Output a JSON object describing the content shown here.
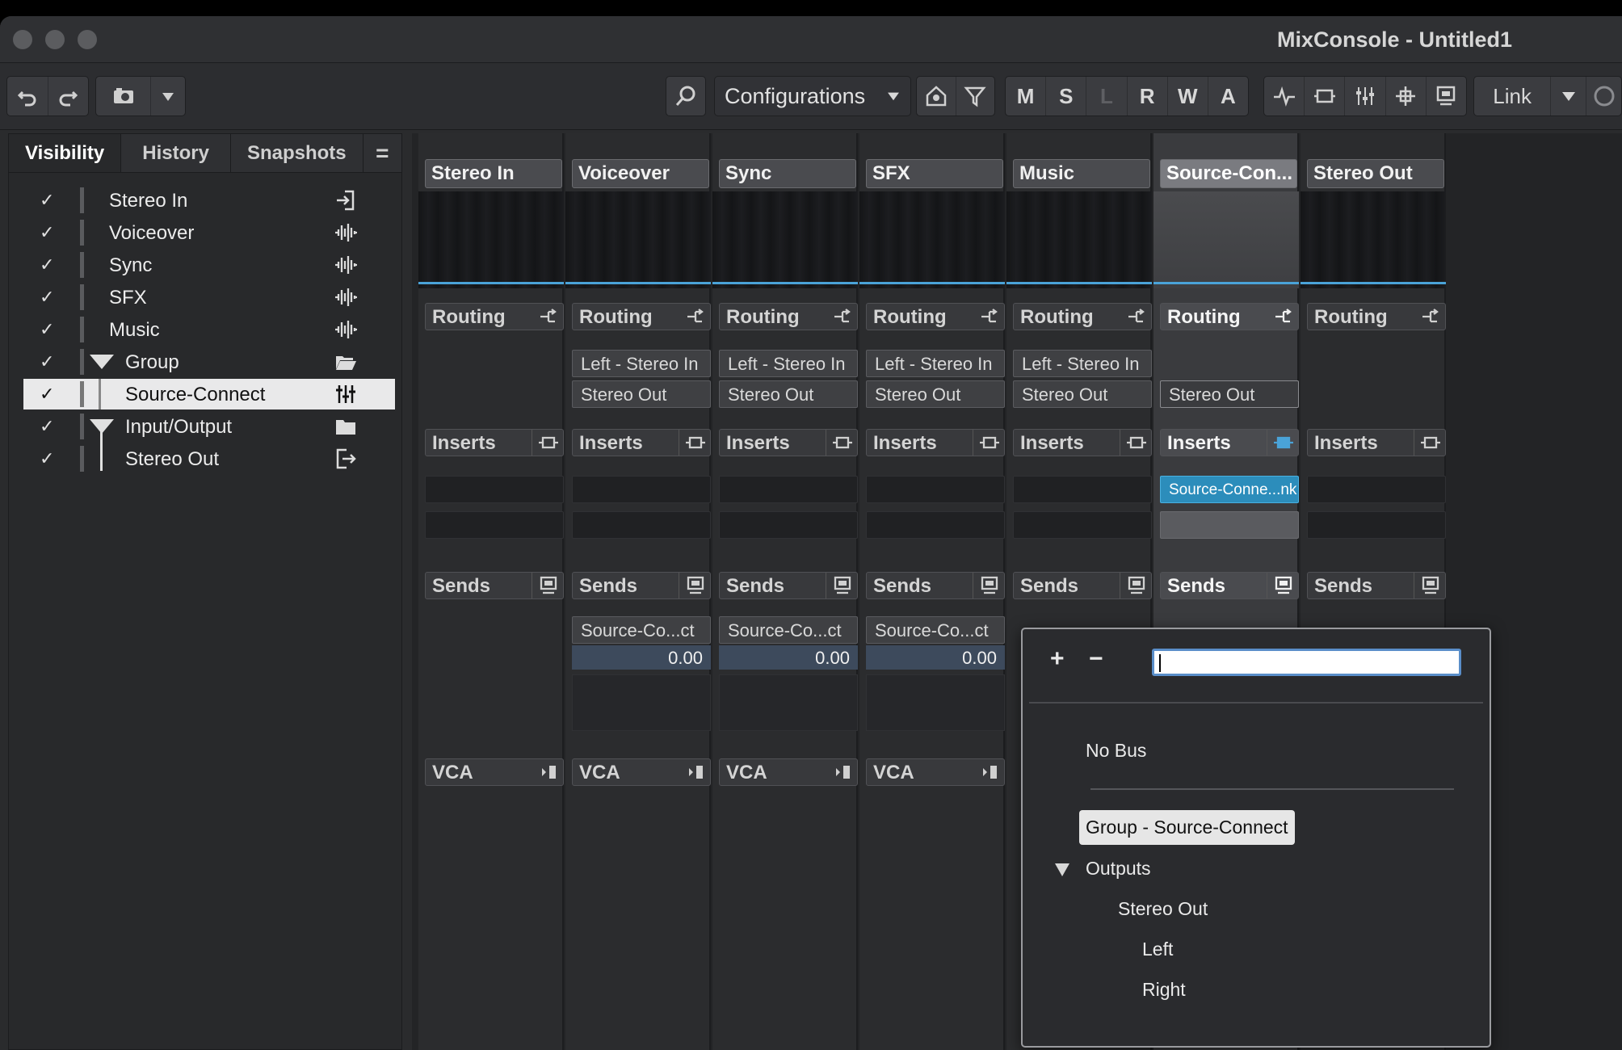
{
  "window": {
    "title": "MixConsole - Untitled1"
  },
  "toolbar": {
    "configurations_label": "Configurations",
    "mode_letters": [
      "M",
      "S",
      "L",
      "R",
      "W",
      "A"
    ],
    "link_label": "Link"
  },
  "left_panel": {
    "tabs": [
      "Visibility",
      "History",
      "Snapshots"
    ],
    "menu_glyph": "=",
    "items": [
      {
        "label": "Stereo In",
        "check": "✓",
        "icon": "input-icon"
      },
      {
        "label": "Voiceover",
        "check": "✓",
        "icon": "audio-waveform-icon"
      },
      {
        "label": "Sync",
        "check": "✓",
        "icon": "audio-waveform-icon"
      },
      {
        "label": "SFX",
        "check": "✓",
        "icon": "audio-waveform-icon"
      },
      {
        "label": "Music",
        "check": "✓",
        "icon": "audio-waveform-icon"
      },
      {
        "label": "Group",
        "check": "✓",
        "icon": "folder-open-icon"
      },
      {
        "label": "Source-Connect",
        "check": "✓",
        "icon": "group-channel-icon"
      },
      {
        "label": "Input/Output",
        "check": "✓",
        "icon": "folder-icon"
      },
      {
        "label": "Stereo Out",
        "check": "✓",
        "icon": "output-icon"
      }
    ]
  },
  "mixer": {
    "section_labels": {
      "routing": "Routing",
      "inserts": "Inserts",
      "sends": "Sends",
      "vca": "VCA"
    },
    "channels": [
      {
        "name": "Stereo In"
      },
      {
        "name": "Voiceover",
        "routing_in": "Left - Stereo In",
        "routing_out": "Stereo Out",
        "send_name": "Source-Co...ct",
        "send_value": "0.00"
      },
      {
        "name": "Sync",
        "routing_in": "Left - Stereo In",
        "routing_out": "Stereo Out",
        "send_name": "Source-Co...ct",
        "send_value": "0.00"
      },
      {
        "name": "SFX",
        "routing_in": "Left - Stereo In",
        "routing_out": "Stereo Out",
        "send_name": "Source-Co...ct",
        "send_value": "0.00"
      },
      {
        "name": "Music",
        "routing_in": "Left - Stereo In",
        "routing_out": "Stereo Out"
      },
      {
        "name": "Source-Con...",
        "routing_out": "Stereo Out",
        "insert_plugin": "Source-Conne...nk"
      },
      {
        "name": "Stereo Out"
      }
    ]
  },
  "popup": {
    "add": "+",
    "remove": "−",
    "search_value": "",
    "no_bus": "No Bus",
    "group_item": "Group - Source-Connect",
    "outputs": "Outputs",
    "stereo_out": "Stereo Out",
    "left": "Left",
    "right": "Right"
  },
  "colors": {
    "accent": "#4aa3d8",
    "plugin": "#2c8dbb",
    "background": "#2a2b2d"
  }
}
